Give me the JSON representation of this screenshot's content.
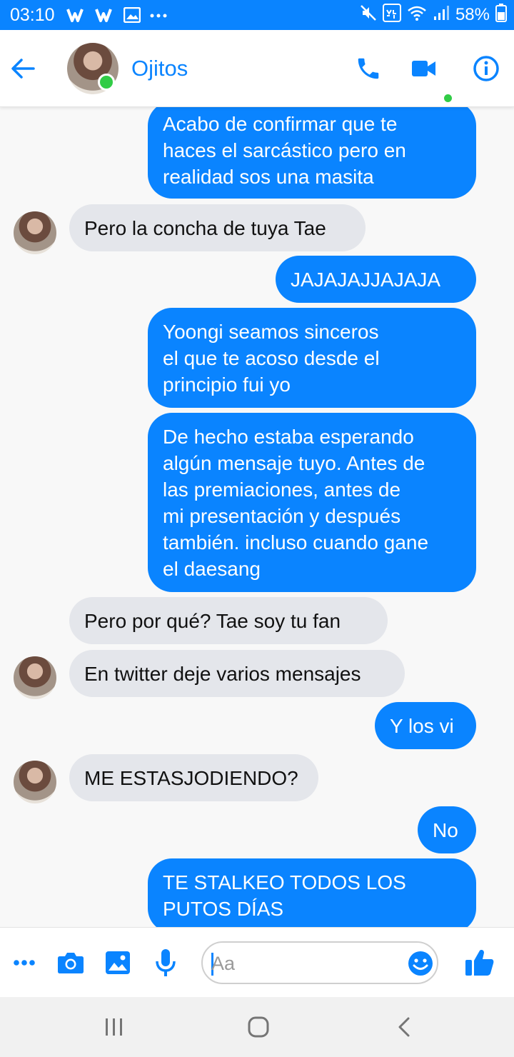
{
  "status_bar": {
    "time": "03:10",
    "battery": "58%",
    "notification_icons": [
      "wattpad-icon",
      "wattpad-icon",
      "gallery-icon",
      "more-icon"
    ],
    "system_icons": [
      "mute-icon",
      "volte-icon",
      "wifi-icon",
      "signal-icon"
    ]
  },
  "header": {
    "contact_name": "Ojitos",
    "online_dot_color": "#31cc46",
    "accent_color": "#0a84ff",
    "actions": [
      "phone-icon",
      "video-icon",
      "info-icon"
    ]
  },
  "messages": [
    {
      "side": "out",
      "text": "Acabo de confirmar que te\nhaces el sarcástico pero en\nrealidad sos una masita"
    },
    {
      "side": "in",
      "text": "Pero la concha de tuya Tae",
      "avatar": true
    },
    {
      "side": "out",
      "text": "JAJAJAJJAJAJA"
    },
    {
      "side": "out",
      "text": "Yoongi seamos sinceros\nel que te acoso desde el\nprincipio fui yo"
    },
    {
      "side": "out",
      "text": "De hecho estaba esperando\nalgún mensaje tuyo. Antes de\nlas premiaciones, antes de\nmi presentación y después\ntambién. incluso cuando gane\nel daesang"
    },
    {
      "side": "in",
      "text": "Pero por qué? Tae soy tu fan",
      "avatar": false
    },
    {
      "side": "in",
      "text": "En twitter deje varios mensajes",
      "avatar": true
    },
    {
      "side": "out",
      "text": "Y los vi"
    },
    {
      "side": "in",
      "text": "ME ESTASJODIENDO?",
      "avatar": true
    },
    {
      "side": "out",
      "text": "No"
    },
    {
      "side": "out",
      "text": "TE STALKEO TODOS LOS\nPUTOS DÍAS"
    }
  ],
  "composer": {
    "placeholder": "Aa",
    "tools": [
      "more-icon",
      "camera-icon",
      "image-icon",
      "microphone-icon"
    ],
    "emoji_icon": "emoji-icon",
    "send_icon": "thumbs-up-icon"
  },
  "nav_bar": {
    "buttons": [
      "recent-apps-icon",
      "home-icon",
      "back-icon"
    ]
  }
}
